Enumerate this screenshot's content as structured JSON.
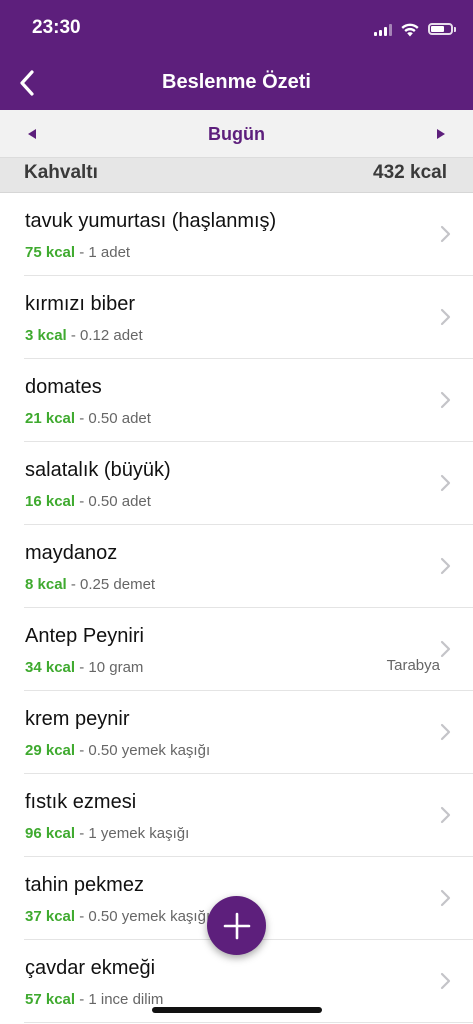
{
  "status_bar": {
    "time": "23:30",
    "battery_level": 0.7,
    "icons": [
      "signal-icon",
      "wifi-icon",
      "battery-icon"
    ]
  },
  "nav": {
    "title": "Beslenme Özeti",
    "back_icon": "chevron-left-icon"
  },
  "date_nav": {
    "label": "Bugün",
    "prev_icon": "triangle-left-icon",
    "next_icon": "triangle-right-icon"
  },
  "meal": {
    "title": "Kahvaltı",
    "total": "432 kcal"
  },
  "items": [
    {
      "name": "tavuk yumurtası (haşlanmış)",
      "kcal": "75 kcal",
      "amount": " - 1 adet",
      "brand": ""
    },
    {
      "name": "kırmızı biber",
      "kcal": "3 kcal",
      "amount": " - 0.12 adet",
      "brand": ""
    },
    {
      "name": "domates",
      "kcal": "21 kcal",
      "amount": " - 0.50 adet",
      "brand": ""
    },
    {
      "name": "salatalık (büyük)",
      "kcal": "16 kcal",
      "amount": " - 0.50 adet",
      "brand": ""
    },
    {
      "name": "maydanoz",
      "kcal": "8 kcal",
      "amount": " - 0.25 demet",
      "brand": ""
    },
    {
      "name": "Antep Peyniri",
      "kcal": "34 kcal",
      "amount": " - 10 gram",
      "brand": "Tarabya"
    },
    {
      "name": "krem peynir",
      "kcal": "29 kcal",
      "amount": " - 0.50 yemek kaşığı",
      "brand": ""
    },
    {
      "name": "fıstık ezmesi",
      "kcal": "96 kcal",
      "amount": " - 1 yemek kaşığı",
      "brand": ""
    },
    {
      "name": "tahin pekmez",
      "kcal": "37 kcal",
      "amount": " - 0.50 yemek kaşığı",
      "brand": ""
    },
    {
      "name": "çavdar ekmeği",
      "kcal": "57 kcal",
      "amount": " - 1 ince dilim",
      "brand": ""
    }
  ],
  "colors": {
    "primary": "#5d1f7c",
    "kcal_green": "#3faa2f",
    "section_bg": "#e6e6e6"
  }
}
